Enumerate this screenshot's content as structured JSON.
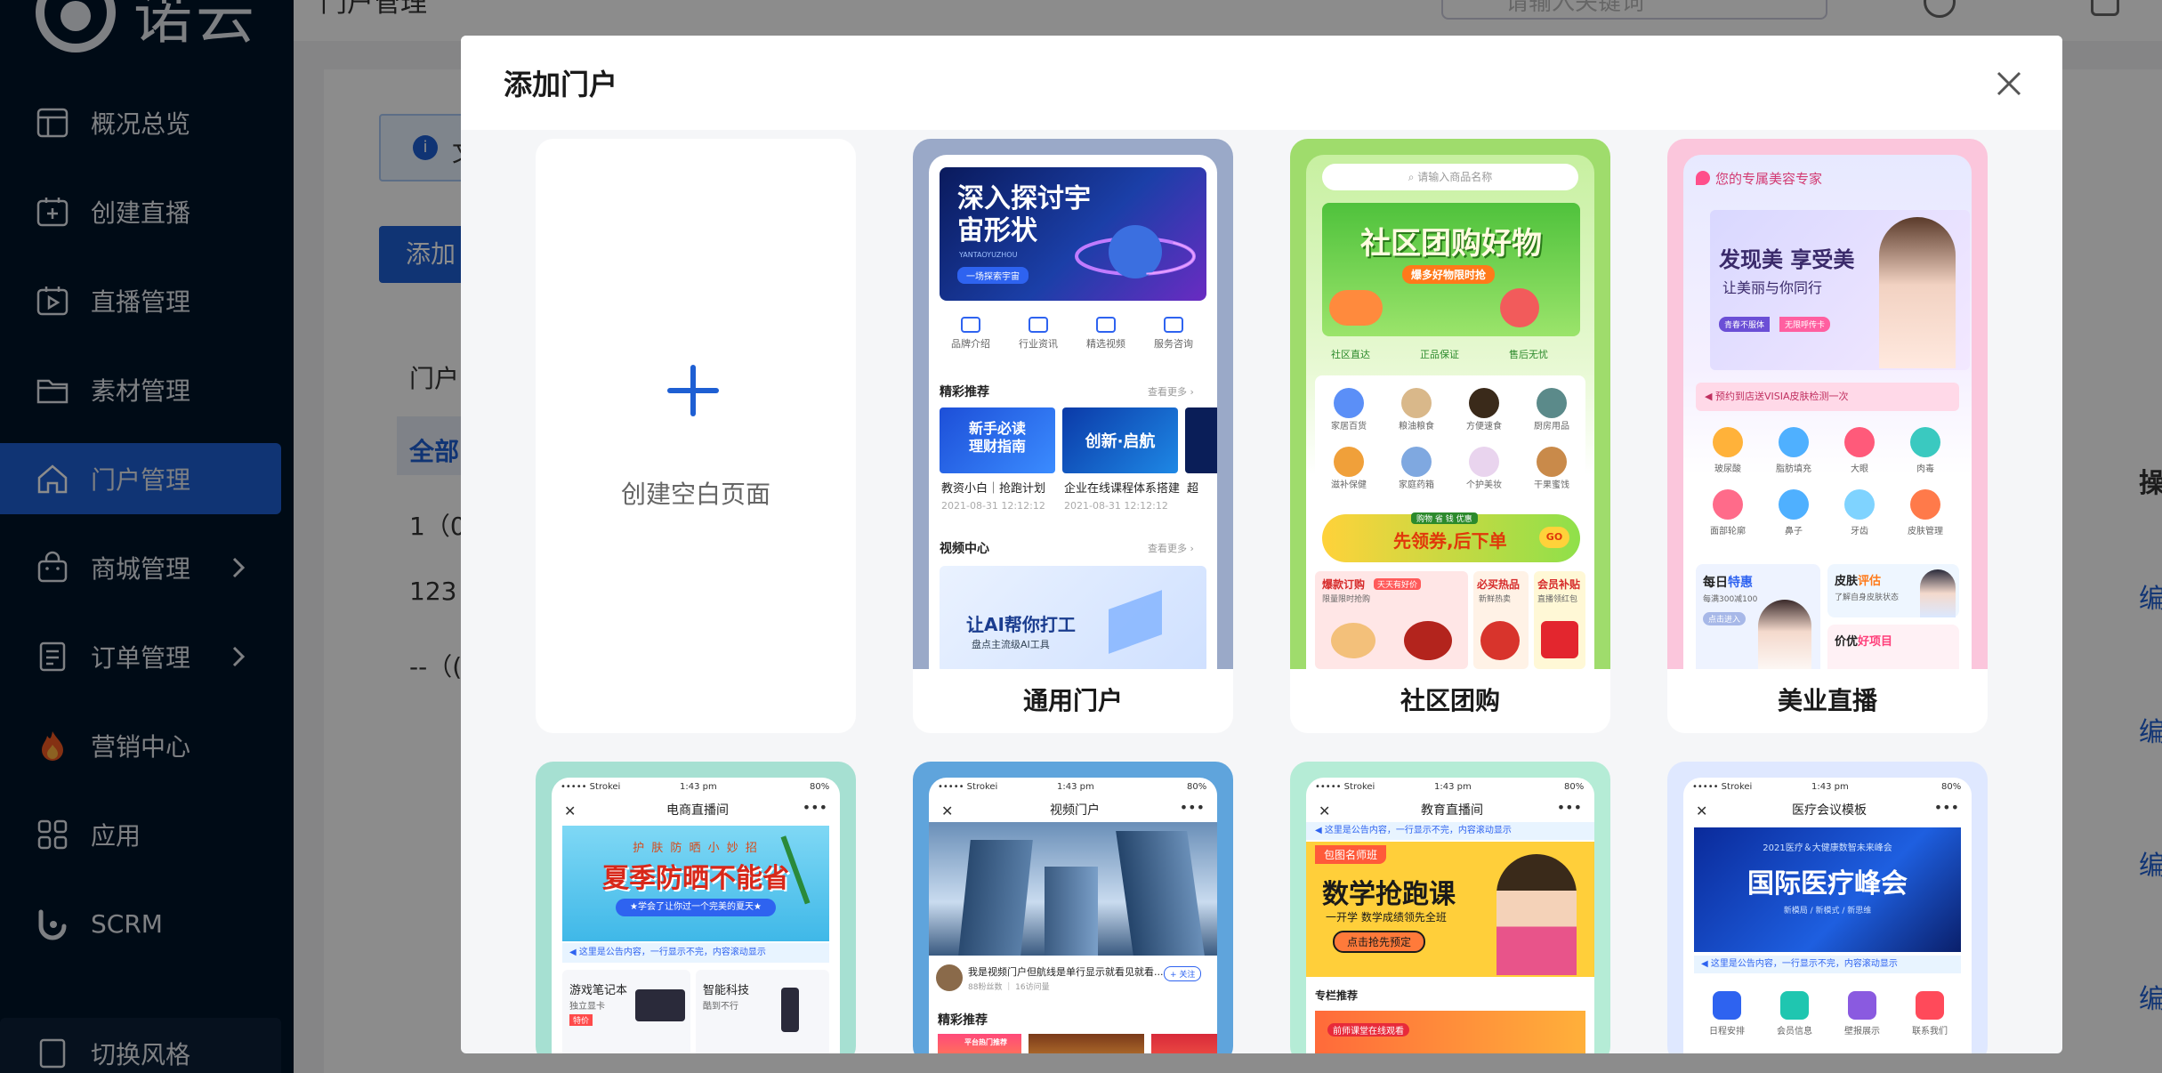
{
  "brand": {
    "name": "诺云"
  },
  "sidebar": {
    "items": [
      {
        "label": "概况总览",
        "icon": "dashboard-icon"
      },
      {
        "label": "创建直播",
        "icon": "add-live-icon"
      },
      {
        "label": "直播管理",
        "icon": "live-icon"
      },
      {
        "label": "素材管理",
        "icon": "folder-icon"
      },
      {
        "label": "门户管理",
        "icon": "home-icon",
        "active": true
      },
      {
        "label": "商城管理",
        "icon": "bag-icon",
        "has_children": true
      },
      {
        "label": "订单管理",
        "icon": "order-icon",
        "has_children": true
      },
      {
        "label": "营销中心",
        "icon": "fire-icon"
      },
      {
        "label": "应用",
        "icon": "apps-icon"
      },
      {
        "label": "SCRM",
        "icon": "scrm-icon"
      }
    ],
    "bottom_label": "切换风格"
  },
  "background": {
    "page_title": "门户管理",
    "search_placeholder": "请输入关键词",
    "info_text": "文",
    "add_button": "添加",
    "filter_label": "门户",
    "tab_all": "全部",
    "rows": [
      "1（0",
      "123",
      "--（("
    ],
    "col_operation": "操",
    "edit_label": "编"
  },
  "modal": {
    "title": "添加门户",
    "blank_label": "创建空白页面",
    "templates": [
      {
        "name": "通用门户",
        "banner_title": "深入探讨宇宙形状",
        "banner_sub": "YANTAOYUZHOU",
        "banner_tag": "一场探索宇宙",
        "icons": [
          "品牌介绍",
          "行业资讯",
          "精选视频",
          "服务咨询"
        ],
        "section1": "精彩推荐",
        "more": "查看更多 ›",
        "cards": [
          {
            "img_text": "新手必读\n理财指南",
            "caption": "教资小白｜抢跑计划",
            "date": "2021-08-31 12:12:12"
          },
          {
            "img_text": "创新·启航",
            "caption": "企业在线课程体系搭建",
            "date": "2021-08-31 12:12:12"
          },
          {
            "img_text": "",
            "caption": "超"
          }
        ],
        "section2": "视频中心",
        "video_text": "让AI帮你打工",
        "video_sub": "盘点主流级AI工具"
      },
      {
        "name": "社区团购",
        "search_placeholder": "请输入商品名称",
        "banner_title": "社区团购好物",
        "banner_sub": "爆多好物限时抢",
        "badges": [
          "社区直达",
          "正品保证",
          "售后无忧"
        ],
        "icons": [
          "家居百货",
          "粮油粮食",
          "方便速食",
          "厨房用品",
          "滋补保健",
          "家庭药箱",
          "个护美妆",
          "干果蜜饯"
        ],
        "coupon_title": "先领券,后下单",
        "coupon_tag": "GO",
        "coupon_top": "购物 省 钱 优惠",
        "promos": [
          {
            "title": "爆款订购",
            "tag": "天天有好价",
            "sub": "限量限时抢购"
          },
          {
            "title": "必买热品",
            "sub": "新鲜热卖"
          },
          {
            "title": "会员补贴",
            "sub": "直播领红包"
          }
        ]
      },
      {
        "name": "美业直播",
        "header_text": "您的专属美容专家",
        "banner_line1": "发现美  享受美",
        "banner_line2": "让美丽与你同行",
        "banner_tag1": "青春不服体",
        "banner_tag2": "无限呼传卡",
        "notice": "预约到店送VISIA皮肤检测一次",
        "icons": [
          "玻尿酸",
          "脂肪填充",
          "大眼",
          "肉毒",
          "面部轮廓",
          "鼻子",
          "牙齿",
          "皮肤管理"
        ],
        "promo1_title": "每日",
        "promo1_highlight": "特惠",
        "promo1_sub": "每满300减100",
        "promo1_btn": "点击进入",
        "promo2_title": "皮肤",
        "promo2_highlight": "评估",
        "promo2_sub": "了解自身皮肤状态",
        "promo3_title": "价优",
        "promo3_highlight": "好项目"
      }
    ],
    "templates_row2": [
      {
        "title": "电商直播间",
        "status_carrier": "••••• Strokei",
        "status_time": "1:43 pm",
        "status_battery": "80%",
        "banner_top": "护 肤 防 晒 小 妙 招",
        "banner_title": "夏季防晒不能省",
        "banner_sub": "★学会了让你过一个完美的夏天★",
        "notice": "这里是公告内容，一行显示不完，内容滚动显示",
        "cards": [
          {
            "title": "游戏笔记本",
            "sub": "独立显卡",
            "tag": "特价"
          },
          {
            "title": "智能科技",
            "sub": "酷到不行"
          }
        ]
      },
      {
        "title": "视频门户",
        "status_carrier": "••••• Strokei",
        "status_time": "1:43 pm",
        "status_battery": "80%",
        "author_text": "我是视频门户但航线是单行显示就看见就看...",
        "author_meta": "88粉丝数 ｜ 16访问量",
        "follow": "+ 关注",
        "section": "精彩推荐",
        "hot_tag": "平台热门推荐"
      },
      {
        "title": "教育直播间",
        "status_carrier": "••••• Strokei",
        "status_time": "1:43 pm",
        "status_battery": "80%",
        "notice": "这里是公告内容，一行显示不完，内容滚动显示",
        "banner_tag": "包图名师班",
        "banner_title": "数学抢跑课",
        "banner_sub": "一开学 数学成绩领先全班",
        "banner_btn": "点击抢先预定",
        "section": "专栏推荐",
        "section_tag": "前师课堂在线观看"
      },
      {
        "title": "医疗会议模板",
        "status_carrier": "••••• Strokei",
        "status_time": "1:43 pm",
        "status_battery": "80%",
        "banner_top": "2021医疗＆大健康数智未来峰会",
        "banner_title": "国际医疗峰会",
        "banner_sub": "新模局 / 新模式 / 新思维",
        "notice": "这里是公告内容，一行显示不完，内容滚动显示",
        "icons": [
          "日程安排",
          "会员信息",
          "壁报展示",
          "联系我们"
        ]
      }
    ]
  },
  "colors": {
    "sidebar_bg": "#001529",
    "primary": "#1e5fd3",
    "modal_bg": "#f5f6f8"
  }
}
